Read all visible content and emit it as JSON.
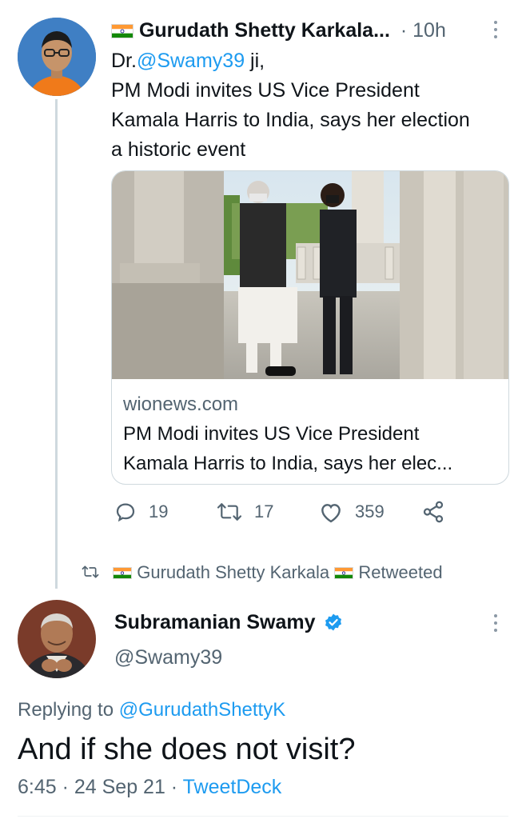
{
  "colors": {
    "accent": "#1d9bf0",
    "muted": "#536471",
    "text": "#0f1419"
  },
  "tweet1": {
    "display_name": "Gurudath Shetty Karkala...",
    "time": "· 10h",
    "line1_prefix": "Dr.",
    "line1_mention": "@Swamy39",
    "line1_suffix": " ji,",
    "text": [
      "PM Modi invites US Vice President",
      "Kamala Harris to India, says her election",
      "a historic event"
    ],
    "card": {
      "domain": "wionews.com",
      "title_lines": [
        "PM Modi invites US Vice President",
        "Kamala Harris to India, says her elec..."
      ]
    },
    "actions": {
      "replies": "19",
      "retweets": "17",
      "likes": "359"
    }
  },
  "retweet_banner": {
    "name": "Gurudath Shetty Karkala",
    "suffix": "Retweeted"
  },
  "tweet2": {
    "display_name": "Subramanian Swamy",
    "handle": "@Swamy39",
    "replying_prefix": "Replying to ",
    "replying_handle": "@GurudathShettyK",
    "text": "And if she does not visit?",
    "time_date": "6:45 · 24 Sep 21 · ",
    "source": "TweetDeck"
  },
  "icons": [
    "india-flag-icon",
    "more-options-icon",
    "reply-icon",
    "retweet-icon",
    "like-icon",
    "share-icon",
    "verified-badge-icon"
  ]
}
